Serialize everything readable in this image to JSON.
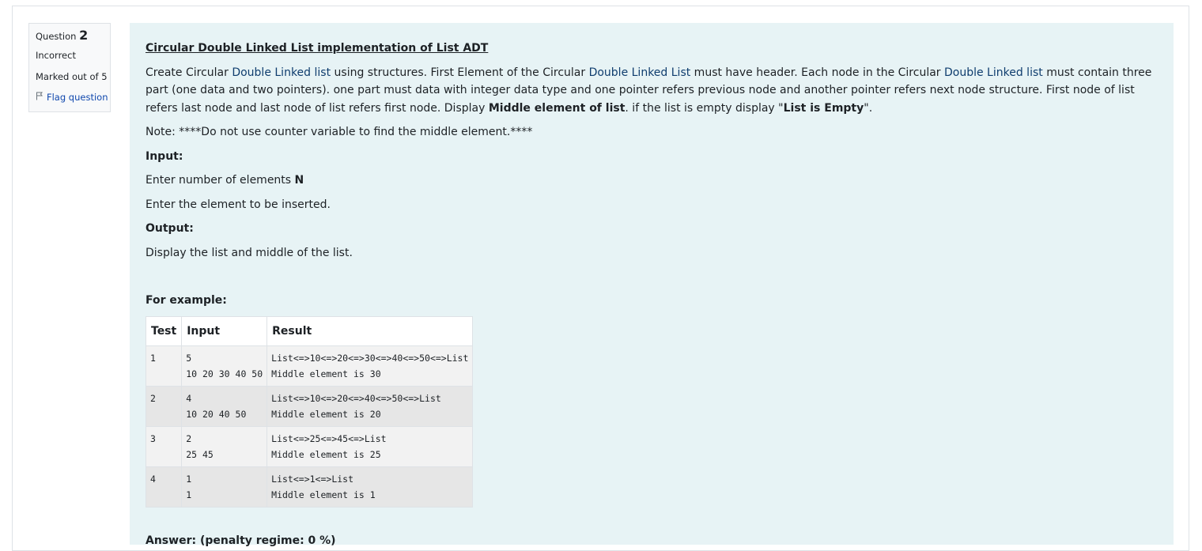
{
  "question_info": {
    "label": "Question",
    "number": "2",
    "state": "Incorrect",
    "grade": "Marked out of 5",
    "flag_label": "Flag question"
  },
  "question": {
    "title": "Circular Double Linked List implementation of List ADT",
    "desc_1": "Create Circular ",
    "desc_link_1": "Double Linked list",
    "desc_2": " using structures. First Element of the Circular ",
    "desc_link_2": "Double Linked List",
    "desc_3": " must have header. Each node in the Circular ",
    "desc_link_3": "Double Linked list",
    "desc_4": " must contain three part (one data and two pointers). one part must data with integer data type and one pointer refers previous node and another pointer refers next node structure. First node of list refers last node and last node of list refers first node. Display ",
    "desc_bold_1": "Middle element of list",
    "desc_5": ". if the list is empty display \"",
    "desc_bold_2": "List is Empty",
    "desc_6": "\".",
    "note": "Note: ****Do not use counter variable to find the middle element.****",
    "input_heading": "Input:",
    "input_line_1_prefix": "Enter number of elements ",
    "input_line_1_bold": "N",
    "input_line_2": "Enter the element to be inserted.",
    "output_heading": "Output:",
    "output_line": "Display the list and middle of the list.",
    "example_heading": "For example:"
  },
  "examples": {
    "headers": [
      "Test",
      "Input",
      "Result"
    ],
    "rows": [
      {
        "test": "1",
        "input": "5\n10 20 30 40 50",
        "result": "List<=>10<=>20<=>30<=>40<=>50<=>List\nMiddle element is 30"
      },
      {
        "test": "2",
        "input": "4\n10 20 40 50",
        "result": "List<=>10<=>20<=>40<=>50<=>List\nMiddle element is 20"
      },
      {
        "test": "3",
        "input": "2\n25 45",
        "result": "List<=>25<=>45<=>List\nMiddle element is 25"
      },
      {
        "test": "4",
        "input": "1\n1",
        "result": "List<=>1<=>List\nMiddle element is 1"
      }
    ]
  },
  "answer_cut": "Answer: (penalty regime: 0 %)"
}
